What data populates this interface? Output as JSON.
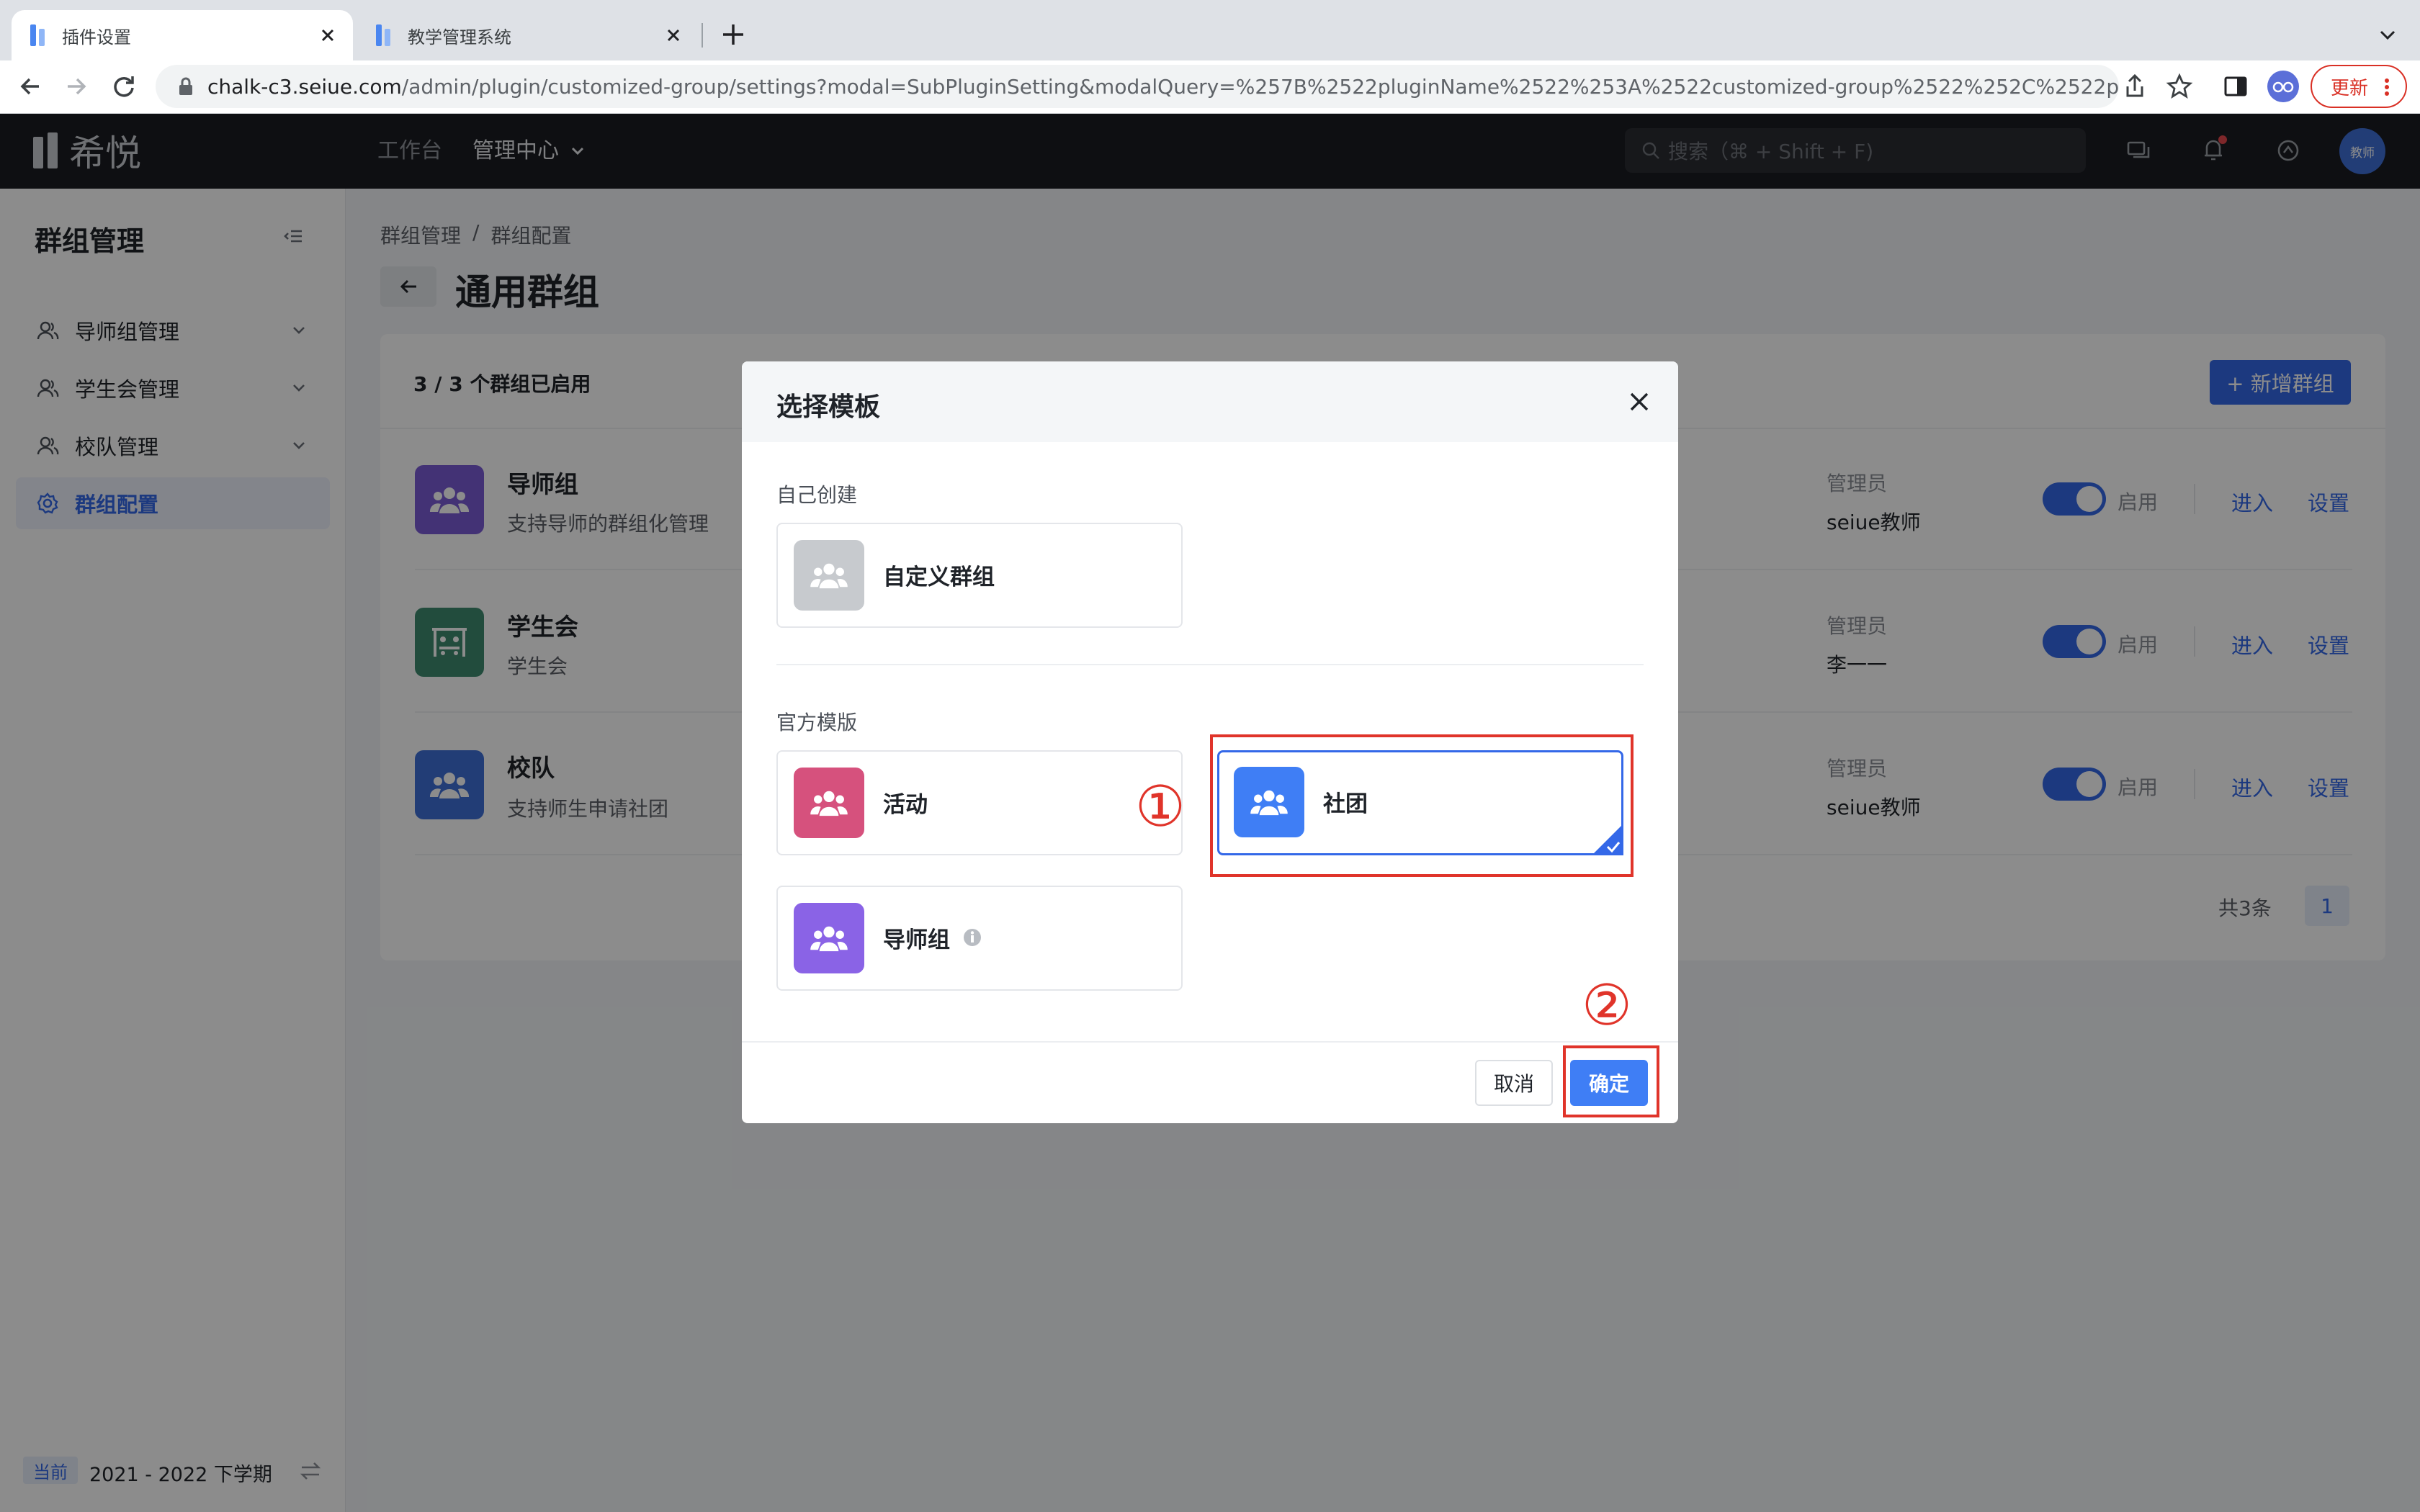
{
  "browser": {
    "tabs": [
      {
        "title": "插件设置",
        "active": true
      },
      {
        "title": "教学管理系统",
        "active": false
      }
    ],
    "url_host": "chalk-c3.seiue.com",
    "url_path": "/admin/plugin/customized-group/settings?modal=SubPluginSetting&modalQuery=%257B%2522pluginName%2522%253A%2522customized-group%2522%252C%2522parentId...",
    "update_label": "更新"
  },
  "header": {
    "logo_text": "希悦",
    "nav": [
      {
        "label": "工作台"
      },
      {
        "label": "管理中心"
      }
    ],
    "search_placeholder": "搜索（⌘ + Shift + F)",
    "avatar_text": "教师"
  },
  "sidebar": {
    "title": "群组管理",
    "items": [
      {
        "label": "导师组管理",
        "icon": "users-icon",
        "expandable": true
      },
      {
        "label": "学生会管理",
        "icon": "users-icon",
        "expandable": true
      },
      {
        "label": "校队管理",
        "icon": "users-icon",
        "expandable": true
      },
      {
        "label": "群组配置",
        "icon": "gear-icon",
        "active": true
      }
    ],
    "footer": {
      "badge": "当前",
      "term": "2021 - 2022 下学期"
    }
  },
  "page": {
    "breadcrumb": [
      "群组管理",
      "群组配置"
    ],
    "breadcrumb_sep": "/",
    "title": "通用群组",
    "enabled_count": "3 / 3 个群组已启用",
    "add_button": "+ 新增群组",
    "groups": [
      {
        "name": "导师组",
        "desc": "支持导师的群组化管理",
        "admin_label": "管理员",
        "admin": "seiue教师",
        "status": "启用",
        "enter": "进入",
        "settings": "设置",
        "color": "#7a5cd6"
      },
      {
        "name": "学生会",
        "desc": "学生会",
        "admin_label": "管理员",
        "admin": "李一一",
        "status": "启用",
        "enter": "进入",
        "settings": "设置",
        "color": "#3e8a70"
      },
      {
        "name": "校队",
        "desc": "支持师生申请社团",
        "admin_label": "管理员",
        "admin": "seiue教师",
        "status": "启用",
        "enter": "进入",
        "settings": "设置",
        "color": "#3f6fd8"
      }
    ],
    "pagination": {
      "total": "共3条",
      "page": "1"
    }
  },
  "modal": {
    "title": "选择模板",
    "section_custom": "自己创建",
    "custom_templates": [
      {
        "label": "自定义群组",
        "color": "#c7cace"
      }
    ],
    "section_official": "官方模版",
    "official_templates": [
      {
        "label": "活动",
        "color": "#d6517d",
        "selected": false
      },
      {
        "label": "社团",
        "color": "#3f7ef5",
        "selected": true
      },
      {
        "label": "导师组",
        "color": "#8a63e6",
        "selected": false,
        "info": true
      }
    ],
    "cancel": "取消",
    "confirm": "确定"
  },
  "annotations": {
    "step1": "①",
    "step2": "②"
  }
}
